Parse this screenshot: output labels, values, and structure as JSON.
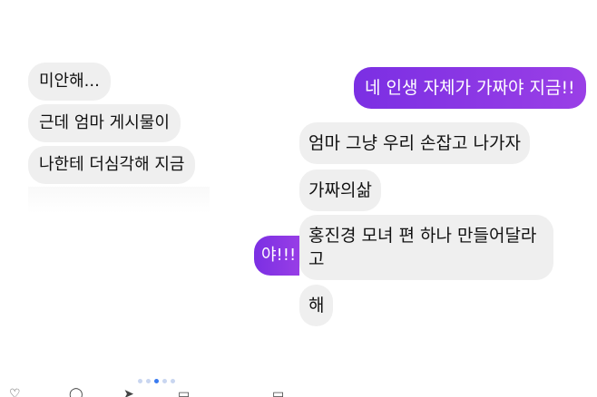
{
  "left_pane": {
    "messages": [
      {
        "text": "미안해..."
      },
      {
        "text": "근데 엄마 게시물이"
      },
      {
        "text": "나한테 더심각해 지금"
      }
    ],
    "sent_message": {
      "text": "야!!!"
    },
    "page_indicator": {
      "count": 5,
      "active_index": 2
    },
    "bottom_bar_icons": [
      "heart-icon",
      "comment-icon",
      "share-icon",
      "bookmark-icon"
    ]
  },
  "right_pane": {
    "sent_message": {
      "text": "네 인생 자체가 가짜야 지금!!"
    },
    "messages": [
      {
        "text": "엄마 그냥 우리 손잡고 나가자"
      },
      {
        "text": "가짜의삶"
      },
      {
        "text": "홍진경 모녀 편 하나 만들어달라고"
      },
      {
        "text": "해"
      }
    ]
  },
  "colors": {
    "incoming_bubble": "#efefef",
    "outgoing_bubble": "#8a2be2",
    "active_dot": "#3a7bf0"
  }
}
